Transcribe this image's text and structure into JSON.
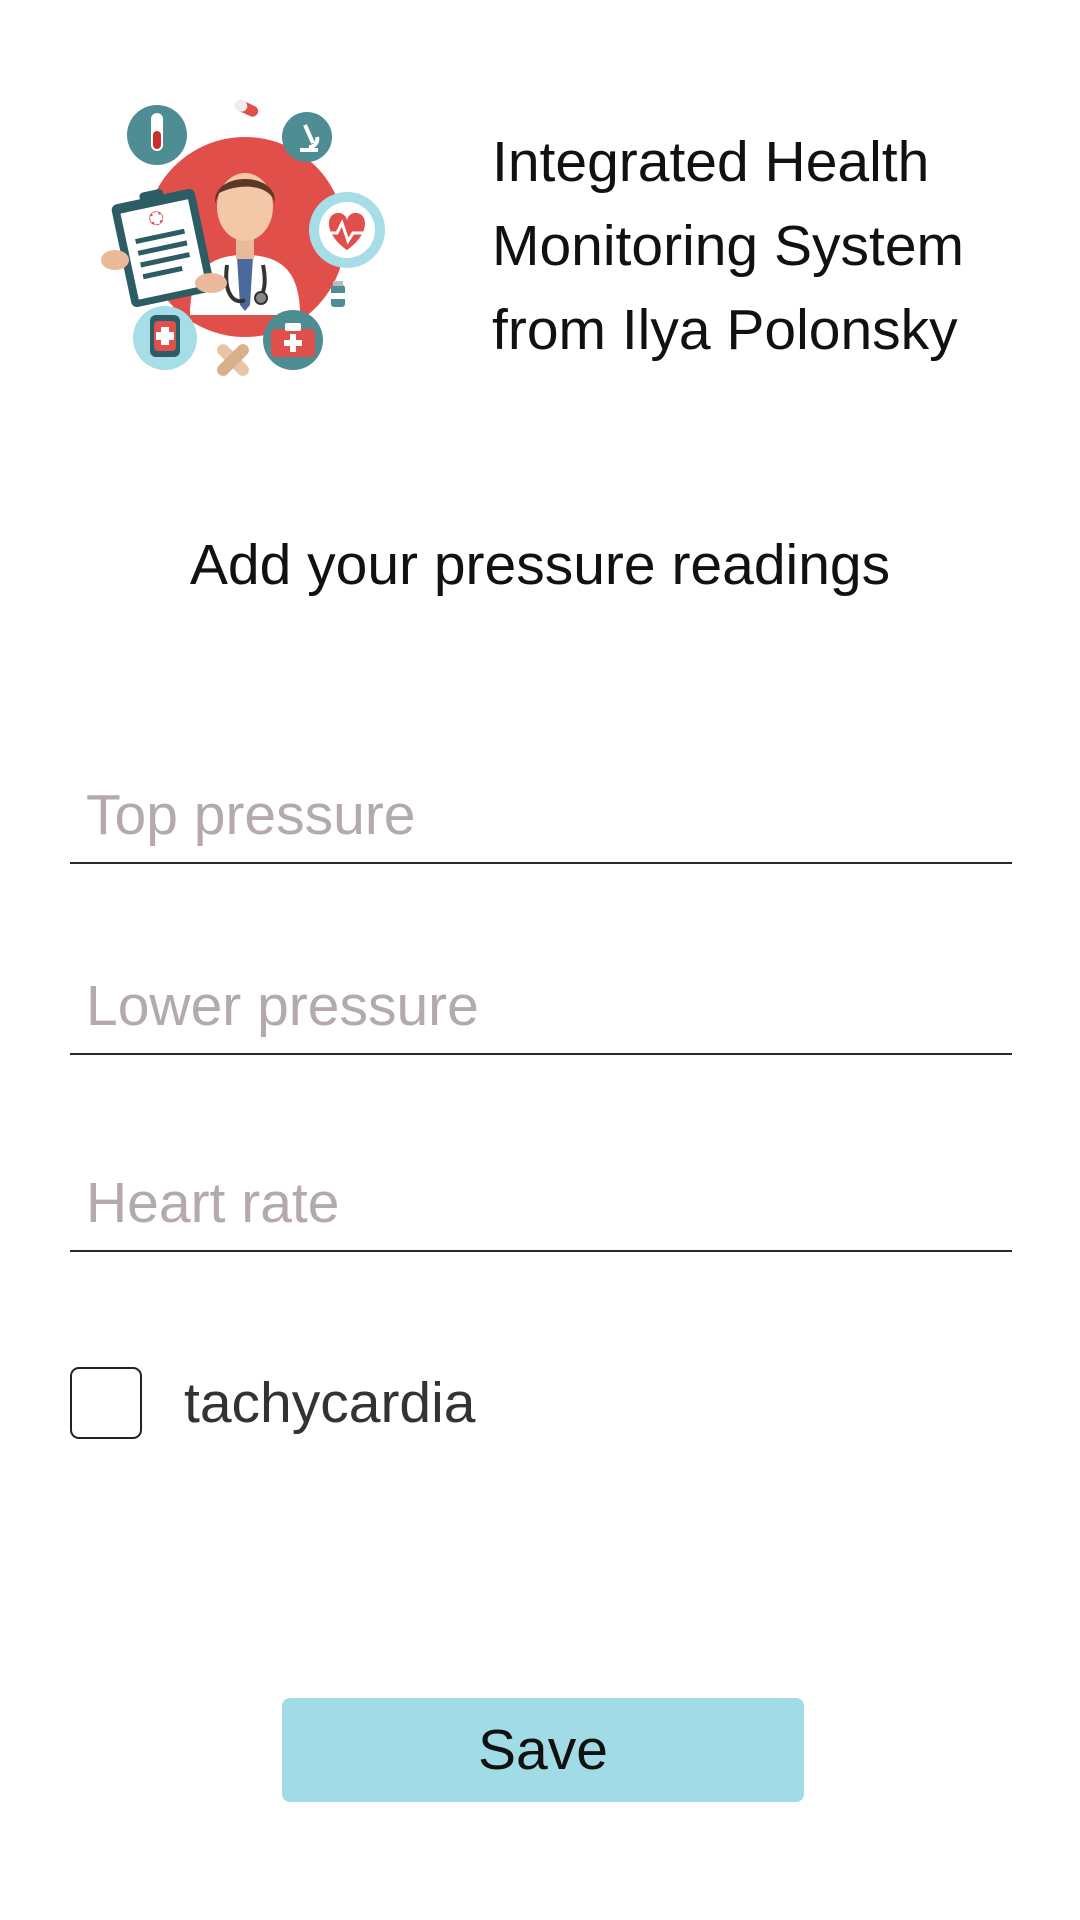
{
  "header": {
    "logo_icon": "doctor-medical-icon",
    "title_lines": [
      "Integrated Health",
      "Monitoring System",
      "from Ilya Polonsky"
    ]
  },
  "form": {
    "heading": "Add your pressure readings",
    "top_pressure": {
      "value": "",
      "placeholder": "Top pressure"
    },
    "lower_pressure": {
      "value": "",
      "placeholder": "Lower pressure"
    },
    "heart_rate": {
      "value": "",
      "placeholder": "Heart rate"
    },
    "tachycardia": {
      "label": "tachycardia",
      "checked": false
    },
    "save_label": "Save"
  },
  "colors": {
    "button_bg": "#a1dbe5",
    "placeholder": "#b5aaab",
    "logo_red": "#e14f4a",
    "logo_teal": "#4e8d93",
    "logo_lightblue": "#a6dde6"
  }
}
